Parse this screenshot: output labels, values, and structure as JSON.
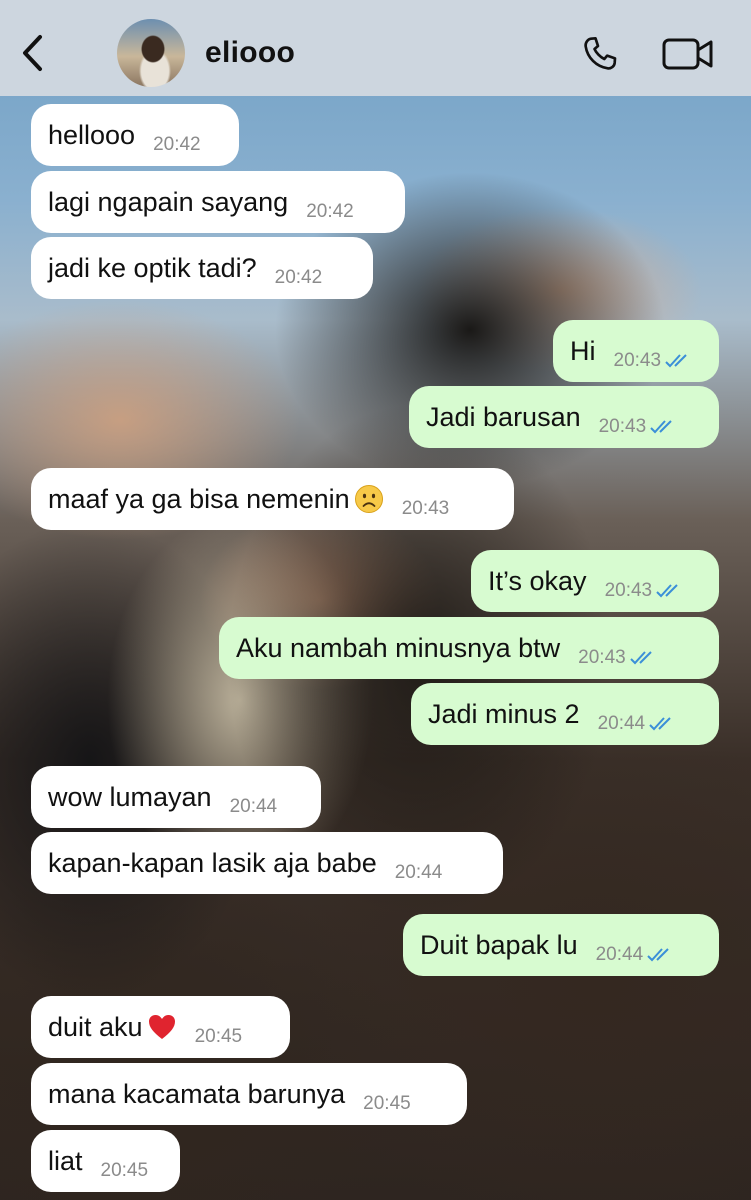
{
  "header": {
    "contact_name": "eliooo"
  },
  "icons": {
    "back": "chevron-left-icon",
    "call": "phone-icon",
    "video": "video-camera-icon",
    "read_receipt": "double-check-icon",
    "sad_emoji": "frowning-face-emoji",
    "heart_emoji": "red-heart-emoji"
  },
  "colors": {
    "header_bg": "#cdd6df",
    "incoming_bubble": "#ffffff",
    "outgoing_bubble": "#d7fbd0",
    "read_tick": "#3b8fd8",
    "timestamp": "#8b8b8b"
  },
  "messages": [
    {
      "dir": "in",
      "text": "hellooo",
      "time": "20:42"
    },
    {
      "dir": "in",
      "text": "lagi ngapain sayang",
      "time": "20:42"
    },
    {
      "dir": "in",
      "text": "jadi ke optik tadi?",
      "time": "20:42"
    },
    {
      "dir": "out",
      "text": "Hi",
      "time": "20:43"
    },
    {
      "dir": "out",
      "text": "Jadi barusan",
      "time": "20:43"
    },
    {
      "dir": "in",
      "text": "maaf ya ga bisa nemenin",
      "time": "20:43",
      "emoji": "frowning-face-emoji"
    },
    {
      "dir": "out",
      "text": "It’s okay",
      "time": "20:43"
    },
    {
      "dir": "out",
      "text": "Aku nambah minusnya btw",
      "time": "20:43"
    },
    {
      "dir": "out",
      "text": "Jadi minus 2",
      "time": "20:44"
    },
    {
      "dir": "in",
      "text": "wow lumayan",
      "time": "20:44"
    },
    {
      "dir": "in",
      "text": "kapan-kapan lasik aja babe",
      "time": "20:44"
    },
    {
      "dir": "out",
      "text": "Duit bapak lu",
      "time": "20:44"
    },
    {
      "dir": "in",
      "text": "duit aku",
      "time": "20:45",
      "emoji": "red-heart-emoji"
    },
    {
      "dir": "in",
      "text": "mana kacamata barunya",
      "time": "20:45"
    },
    {
      "dir": "in",
      "text": "liat",
      "time": "20:45"
    }
  ]
}
